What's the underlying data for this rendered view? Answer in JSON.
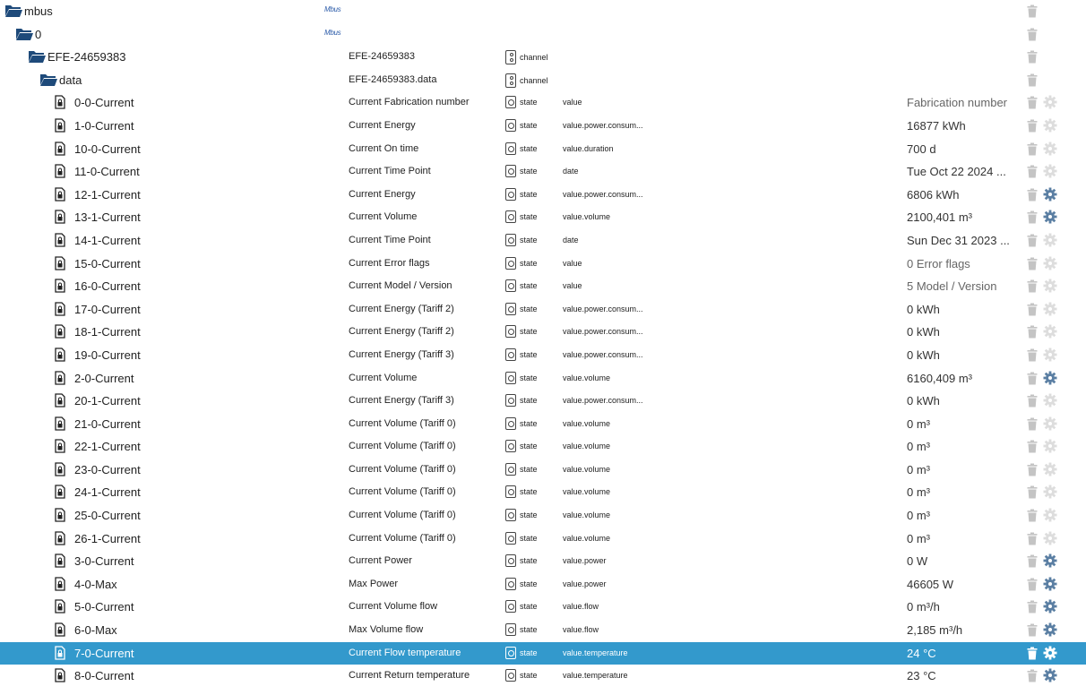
{
  "colors": {
    "folder": "#1e4a7a",
    "selected_row": "#3399cc",
    "gear_active": "#5b7fa3",
    "gear_inactive": "#dddddd",
    "trash": "#c4c4c4"
  },
  "rows": [
    {
      "level": 0,
      "kind": "folder",
      "name": "mbus",
      "logo": "Mbus"
    },
    {
      "level": 1,
      "kind": "folder",
      "name": "0",
      "logo": "Mbus"
    },
    {
      "level": 2,
      "kind": "folder",
      "name": "EFE-24659383",
      "title": "EFE-24659383",
      "type": "channel"
    },
    {
      "level": 3,
      "kind": "folder",
      "name": "data",
      "title": "EFE-24659383.data",
      "type": "channel"
    },
    {
      "level": 4,
      "kind": "state",
      "name": "0-0-Current",
      "title": "Current Fabrication number",
      "type": "state",
      "role": "value",
      "value": "Fabrication number",
      "muted": true,
      "gear": false
    },
    {
      "level": 4,
      "kind": "state",
      "name": "1-0-Current",
      "title": "Current Energy",
      "type": "state",
      "role": "value.power.consum...",
      "value": "16877",
      "unit": " kWh",
      "gear": false
    },
    {
      "level": 4,
      "kind": "state",
      "name": "10-0-Current",
      "title": "Current On time",
      "type": "state",
      "role": "value.duration",
      "value": "700",
      "unit": " d",
      "gear": false
    },
    {
      "level": 4,
      "kind": "state",
      "name": "11-0-Current",
      "title": "Current Time Point",
      "type": "state",
      "role": "date",
      "value": "Tue Oct 22 2024 ...",
      "gear": false
    },
    {
      "level": 4,
      "kind": "state",
      "name": "12-1-Current",
      "title": "Current Energy",
      "type": "state",
      "role": "value.power.consum...",
      "value": "6806",
      "unit": " kWh",
      "gear": true
    },
    {
      "level": 4,
      "kind": "state",
      "name": "13-1-Current",
      "title": "Current Volume",
      "type": "state",
      "role": "value.volume",
      "value": "2100,401",
      "unit": " m³",
      "gear": true
    },
    {
      "level": 4,
      "kind": "state",
      "name": "14-1-Current",
      "title": "Current Time Point",
      "type": "state",
      "role": "date",
      "value": "Sun Dec 31 2023 ...",
      "gear": false
    },
    {
      "level": 4,
      "kind": "state",
      "name": "15-0-Current",
      "title": "Current Error flags",
      "type": "state",
      "role": "value",
      "value": "0 Error flags",
      "muted": true,
      "gear": false
    },
    {
      "level": 4,
      "kind": "state",
      "name": "16-0-Current",
      "title": "Current Model / Version",
      "type": "state",
      "role": "value",
      "value": "5 Model / Version",
      "muted": true,
      "gear": false
    },
    {
      "level": 4,
      "kind": "state",
      "name": "17-0-Current",
      "title": "Current Energy (Tariff 2)",
      "type": "state",
      "role": "value.power.consum...",
      "value": "0",
      "unit": " kWh",
      "gear": false
    },
    {
      "level": 4,
      "kind": "state",
      "name": "18-1-Current",
      "title": "Current Energy (Tariff 2)",
      "type": "state",
      "role": "value.power.consum...",
      "value": "0",
      "unit": " kWh",
      "gear": false
    },
    {
      "level": 4,
      "kind": "state",
      "name": "19-0-Current",
      "title": "Current Energy (Tariff 3)",
      "type": "state",
      "role": "value.power.consum...",
      "value": "0",
      "unit": " kWh",
      "gear": false
    },
    {
      "level": 4,
      "kind": "state",
      "name": "2-0-Current",
      "title": "Current Volume",
      "type": "state",
      "role": "value.volume",
      "value": "6160,409",
      "unit": " m³",
      "gear": true
    },
    {
      "level": 4,
      "kind": "state",
      "name": "20-1-Current",
      "title": "Current Energy (Tariff 3)",
      "type": "state",
      "role": "value.power.consum...",
      "value": "0",
      "unit": " kWh",
      "gear": false
    },
    {
      "level": 4,
      "kind": "state",
      "name": "21-0-Current",
      "title": "Current Volume (Tariff 0)",
      "type": "state",
      "role": "value.volume",
      "value": "0",
      "unit": " m³",
      "gear": false
    },
    {
      "level": 4,
      "kind": "state",
      "name": "22-1-Current",
      "title": "Current Volume (Tariff 0)",
      "type": "state",
      "role": "value.volume",
      "value": "0",
      "unit": " m³",
      "gear": false
    },
    {
      "level": 4,
      "kind": "state",
      "name": "23-0-Current",
      "title": "Current Volume (Tariff 0)",
      "type": "state",
      "role": "value.volume",
      "value": "0",
      "unit": " m³",
      "gear": false
    },
    {
      "level": 4,
      "kind": "state",
      "name": "24-1-Current",
      "title": "Current Volume (Tariff 0)",
      "type": "state",
      "role": "value.volume",
      "value": "0",
      "unit": " m³",
      "gear": false
    },
    {
      "level": 4,
      "kind": "state",
      "name": "25-0-Current",
      "title": "Current Volume (Tariff 0)",
      "type": "state",
      "role": "value.volume",
      "value": "0",
      "unit": " m³",
      "gear": false
    },
    {
      "level": 4,
      "kind": "state",
      "name": "26-1-Current",
      "title": "Current Volume (Tariff 0)",
      "type": "state",
      "role": "value.volume",
      "value": "0",
      "unit": " m³",
      "gear": false
    },
    {
      "level": 4,
      "kind": "state",
      "name": "3-0-Current",
      "title": "Current Power",
      "type": "state",
      "role": "value.power",
      "value": "0",
      "unit": " W",
      "gear": true
    },
    {
      "level": 4,
      "kind": "state",
      "name": "4-0-Max",
      "title": "Max Power",
      "type": "state",
      "role": "value.power",
      "value": "46605",
      "unit": " W",
      "gear": true
    },
    {
      "level": 4,
      "kind": "state",
      "name": "5-0-Current",
      "title": "Current Volume flow",
      "type": "state",
      "role": "value.flow",
      "value": "0",
      "unit": " m³/h",
      "gear": true
    },
    {
      "level": 4,
      "kind": "state",
      "name": "6-0-Max",
      "title": "Max Volume flow",
      "type": "state",
      "role": "value.flow",
      "value": "2,185",
      "unit": " m³/h",
      "gear": true
    },
    {
      "level": 4,
      "kind": "state",
      "name": "7-0-Current",
      "title": "Current Flow temperature",
      "type": "state",
      "role": "value.temperature",
      "value": "24",
      "unit": " °C",
      "gear": true,
      "selected": true
    },
    {
      "level": 4,
      "kind": "state",
      "name": "8-0-Current",
      "title": "Current Return temperature",
      "type": "state",
      "role": "value.temperature",
      "value": "23",
      "unit": " °C",
      "gear": true
    }
  ]
}
